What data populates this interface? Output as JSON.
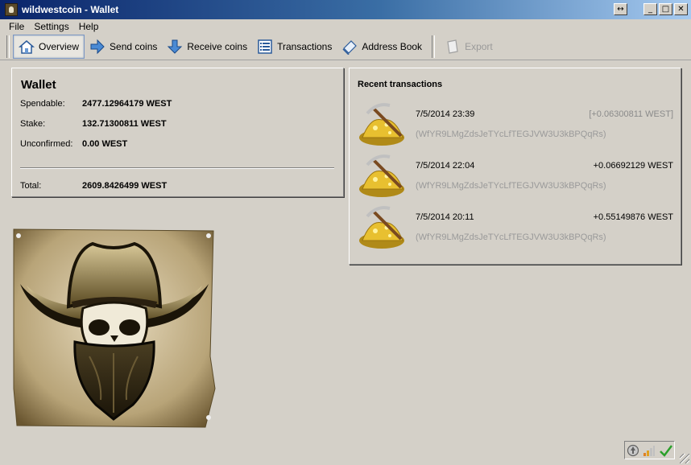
{
  "window": {
    "title": "wildwestcoin - Wallet"
  },
  "menu": {
    "items": [
      "File",
      "Settings",
      "Help"
    ]
  },
  "toolbar": {
    "overview": "Overview",
    "send": "Send coins",
    "receive": "Receive coins",
    "transactions": "Transactions",
    "address_book": "Address Book",
    "export": "Export"
  },
  "wallet": {
    "title": "Wallet",
    "spendable_label": "Spendable:",
    "spendable_value": "2477.12964179 WEST",
    "stake_label": "Stake:",
    "stake_value": "132.71300811 WEST",
    "unconfirmed_label": "Unconfirmed:",
    "unconfirmed_value": "0.00 WEST",
    "total_label": "Total:",
    "total_value": "2609.8426499 WEST"
  },
  "recent": {
    "title": "Recent transactions",
    "items": [
      {
        "date": "7/5/2014 23:39",
        "amount": "[+0.06300811 WEST]",
        "address": "(WfYR9LMgZdsJeTYcLfTEGJVW3U3kBPQqRs)",
        "pending": true
      },
      {
        "date": "7/5/2014 22:04",
        "amount": "+0.06692129 WEST",
        "address": "(WfYR9LMgZdsJeTYcLfTEGJVW3U3kBPQqRs)",
        "pending": false
      },
      {
        "date": "7/5/2014 20:11",
        "amount": "+0.55149876 WEST",
        "address": "(WfYR9LMgZdsJeTYcLfTEGJVW3U3kBPQqRs)",
        "pending": false
      }
    ]
  },
  "icons": {
    "app": "wildwestcoin-logo-icon",
    "overview": "home-icon",
    "send": "send-arrow-icon",
    "receive": "receive-arrow-icon",
    "transactions": "list-icon",
    "address_book": "address-book-icon",
    "export": "export-icon",
    "tx": "gold-pickaxe-icon",
    "status": [
      "staking-icon",
      "connections-icon",
      "synced-check-icon"
    ]
  },
  "colors": {
    "title_start": "#0a246a",
    "title_end": "#a6caf0",
    "window_bg": "#d4d0c8",
    "address_gray": "#9a9a9a"
  }
}
